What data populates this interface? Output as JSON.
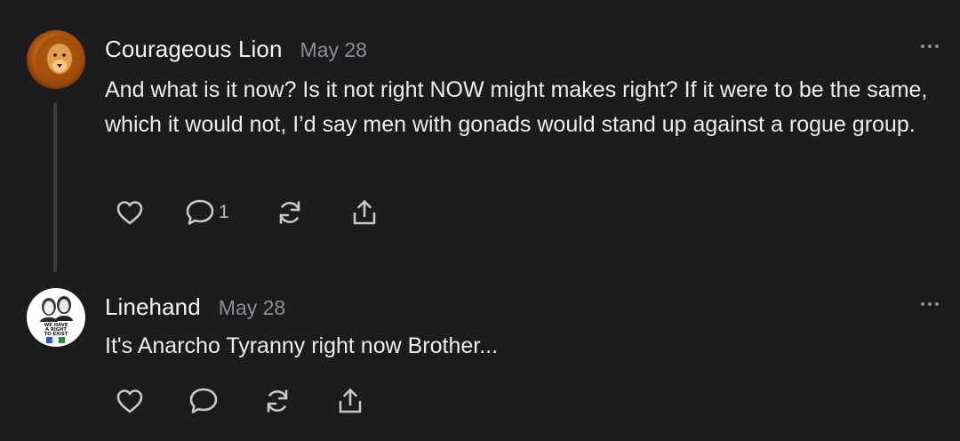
{
  "comments": [
    {
      "author": "Courageous Lion",
      "date": "May 28",
      "text": "And what is it now? Is it not right NOW might makes right? If it were to be the same, which it would not, I’d say men with gonads would stand up against a rogue group.",
      "reply_count": "1",
      "avatar_icon": "lion-avatar-icon"
    },
    {
      "author": "Linehand",
      "date": "May 28",
      "text": "It's Anarcho Tyranny right now Brother...",
      "reply_count": "",
      "avatar_icon": "portrait-avatar-icon",
      "avatar_caption": "WE HAVE A RIGHT TO EXIST"
    }
  ],
  "icons": {
    "like": "heart-icon",
    "reply": "comment-bubble-icon",
    "restack": "restack-icon",
    "share": "share-icon",
    "more": "more-options-icon"
  },
  "colors": {
    "background": "#1c1c1e",
    "text": "#ececec",
    "muted": "#8d8d92",
    "icon": "#c9c9cc",
    "thread_line": "#3d3d40"
  }
}
